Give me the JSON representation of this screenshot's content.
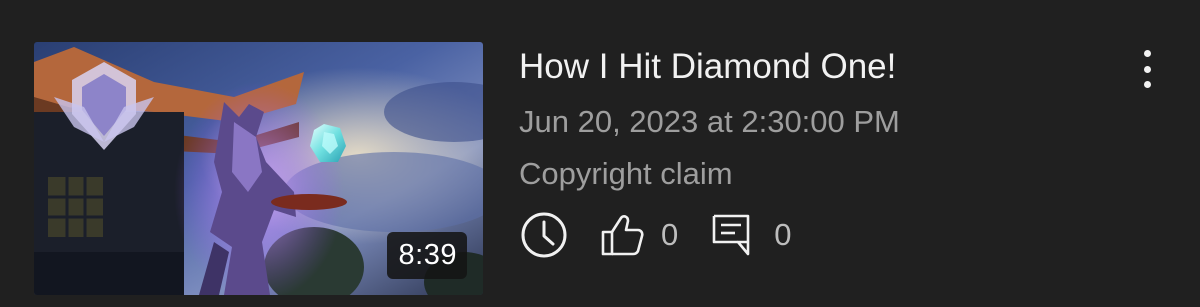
{
  "video": {
    "title": "How I Hit Diamond One!",
    "date": "Jun 20, 2023 at 2:30:00 PM",
    "status": "Copyright claim",
    "duration": "8:39",
    "likes": "0",
    "comments": "0"
  },
  "icons": {
    "visibility": "clock-icon",
    "likes": "thumbs-up-icon",
    "comments": "comment-icon",
    "menu": "more-vert-icon"
  },
  "colors": {
    "background": "#202020",
    "title": "#f1f1f1",
    "meta": "#9e9e9e",
    "stat": "#bdbdbd"
  }
}
